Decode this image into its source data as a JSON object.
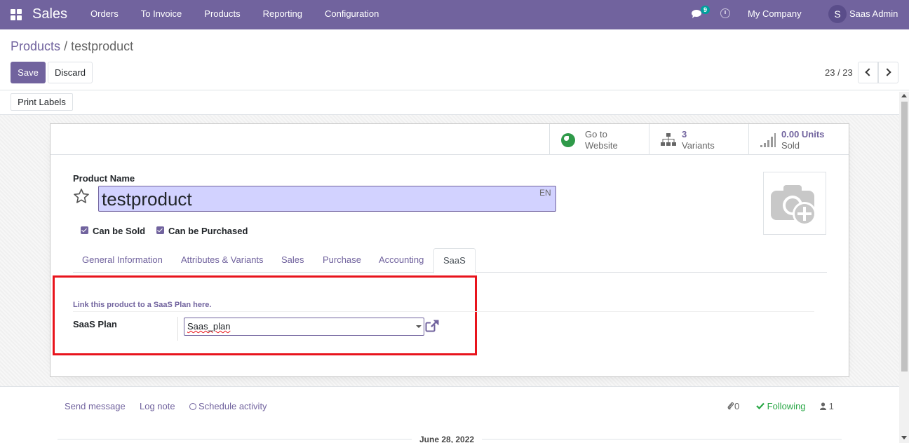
{
  "navbar": {
    "app_name": "Sales",
    "menu": [
      "Orders",
      "To Invoice",
      "Products",
      "Reporting",
      "Configuration"
    ],
    "chat_count": "9",
    "company": "My Company",
    "avatar_initial": "S",
    "user": "Saas Admin"
  },
  "breadcrumb": {
    "parent": "Products",
    "separator": "/",
    "current": "testproduct"
  },
  "buttons": {
    "save": "Save",
    "discard": "Discard",
    "print_labels": "Print Labels"
  },
  "pager": {
    "value": "23 / 23"
  },
  "stat_buttons": {
    "website": {
      "line1": "Go to",
      "line2": "Website"
    },
    "variants": {
      "value": "3",
      "label": "Variants"
    },
    "sold": {
      "value": "0.00 Units",
      "label": "Sold"
    }
  },
  "form": {
    "product_name_label": "Product Name",
    "product_name": "testproduct",
    "lang": "EN",
    "can_be_sold": "Can be Sold",
    "can_be_purchased": "Can be Purchased"
  },
  "tabs": [
    "General Information",
    "Attributes & Variants",
    "Sales",
    "Purchase",
    "Accounting",
    "SaaS"
  ],
  "active_tab": "SaaS",
  "saas": {
    "hint": "Link this product to a SaaS Plan here.",
    "plan_label": "SaaS Plan",
    "plan_value": "Saas_plan"
  },
  "chatter": {
    "send_message": "Send message",
    "log_note": "Log note",
    "schedule_activity": "Schedule activity",
    "attachments": "0",
    "following": "Following",
    "followers": "1",
    "date": "June 28, 2022"
  },
  "colors": {
    "primary": "#71639e",
    "highlight": "#e8141c",
    "following": "#28a745"
  }
}
